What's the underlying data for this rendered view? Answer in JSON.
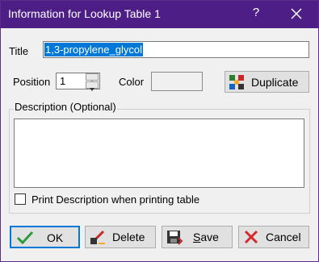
{
  "window": {
    "title": "Information for Lookup Table 1",
    "help_label": "?"
  },
  "form": {
    "title_label": "Title",
    "title_value": "1,3-propylene_glycol",
    "position_label": "Position",
    "position_value": "1",
    "color_label": "Color",
    "duplicate_label": "Duplicate",
    "description_label": "Description (Optional)",
    "description_value": "",
    "print_description_label": "Print Description when printing table",
    "print_description_checked": false
  },
  "buttons": {
    "ok": "OK",
    "delete": "Delete",
    "save_prefix": "S",
    "save_rest": "ave",
    "cancel": "Cancel"
  },
  "colors": {
    "titlebar": "#4d1e86",
    "selection": "#0078d7",
    "ok_check": "#2e9b3a",
    "cancel_x": "#d22b2b"
  }
}
